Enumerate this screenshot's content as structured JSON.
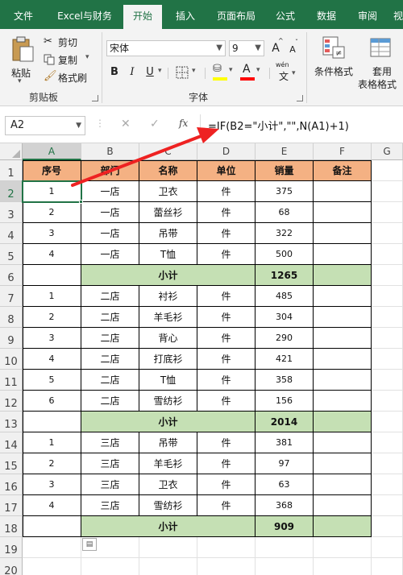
{
  "tabs": [
    "文件",
    "Excel与财务",
    "开始",
    "插入",
    "页面布局",
    "公式",
    "数据",
    "审阅",
    "视"
  ],
  "ribbon": {
    "paste_label": "粘贴",
    "cut_label": "剪切",
    "copy_label": "复制",
    "format_painter_label": "格式刷",
    "clipboard_group": "剪贴板",
    "font_name": "宋体",
    "font_size": "9",
    "font_group": "字体",
    "bold": "B",
    "italic": "I",
    "underline": "U",
    "grow_font": "A",
    "shrink_font": "A",
    "font_color": "A",
    "wen_label": "wén",
    "wen_char": "文",
    "cond_format_label": "条件格式",
    "table_format_label1": "套用",
    "table_format_label2": "表格格式"
  },
  "formula_bar": {
    "name_box": "A2",
    "fx": "fx",
    "cancel": "✕",
    "enter": "✓",
    "formula": "=IF(B2=\"小计\",\"\",N(A1)+1)"
  },
  "col_letters": [
    "A",
    "B",
    "C",
    "D",
    "E",
    "F",
    "G"
  ],
  "row_numbers": [
    "1",
    "2",
    "3",
    "4",
    "5",
    "6",
    "7",
    "8",
    "9",
    "10",
    "11",
    "12",
    "13",
    "14",
    "15",
    "16",
    "17",
    "18",
    "19",
    "20"
  ],
  "headers": [
    "序号",
    "部门",
    "名称",
    "单位",
    "销量",
    "备注"
  ],
  "rows": [
    [
      "1",
      "一店",
      "卫衣",
      "件",
      "375",
      ""
    ],
    [
      "2",
      "一店",
      "蕾丝衫",
      "件",
      "68",
      ""
    ],
    [
      "3",
      "一店",
      "吊带",
      "件",
      "322",
      ""
    ],
    [
      "4",
      "一店",
      "T恤",
      "件",
      "500",
      ""
    ],
    [
      "",
      "小计",
      "",
      "",
      "1265",
      ""
    ],
    [
      "1",
      "二店",
      "衬衫",
      "件",
      "485",
      ""
    ],
    [
      "2",
      "二店",
      "羊毛衫",
      "件",
      "304",
      ""
    ],
    [
      "3",
      "二店",
      "背心",
      "件",
      "290",
      ""
    ],
    [
      "4",
      "二店",
      "打底衫",
      "件",
      "421",
      ""
    ],
    [
      "5",
      "二店",
      "T恤",
      "件",
      "358",
      ""
    ],
    [
      "6",
      "二店",
      "雪纺衫",
      "件",
      "156",
      ""
    ],
    [
      "",
      "小计",
      "",
      "",
      "2014",
      ""
    ],
    [
      "1",
      "三店",
      "吊带",
      "件",
      "381",
      ""
    ],
    [
      "2",
      "三店",
      "羊毛衫",
      "件",
      "97",
      ""
    ],
    [
      "3",
      "三店",
      "卫衣",
      "件",
      "63",
      ""
    ],
    [
      "4",
      "三店",
      "雪纺衫",
      "件",
      "368",
      ""
    ],
    [
      "",
      "小计",
      "",
      "",
      "909",
      ""
    ]
  ],
  "colors": {
    "brand": "#217346",
    "header_fill": "#f4b183",
    "subtotal_fill": "#c5e0b4",
    "arrow": "#ee2222"
  }
}
